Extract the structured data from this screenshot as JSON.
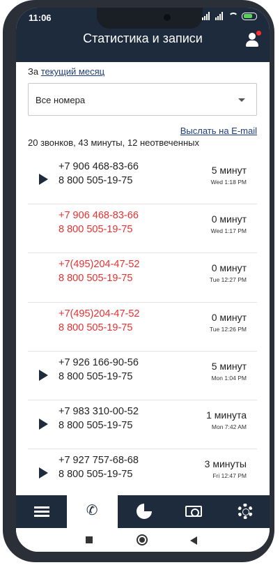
{
  "status": {
    "time": "11:06"
  },
  "header": {
    "title": "Статистика и записи",
    "profile_icon": "user-icon"
  },
  "period": {
    "prefix": "За",
    "link": "текущий месяц"
  },
  "filter": {
    "selected": "Все номера"
  },
  "email_link": "Выслать на E-mail",
  "summary": "20 звонков, 43 минуты, 12 неотвеченных",
  "colors": {
    "header_bg": "#1d2b3c",
    "missed": "#e83030",
    "link": "#1f3d7a"
  },
  "calls": [
    {
      "from": "+7 906 468-83-66",
      "to": "8 800 505-19-75",
      "duration": "5 минут",
      "time": "Wed 1:18 PM",
      "missed": false,
      "has_record": true
    },
    {
      "from": "+7 906 468-83-66",
      "to": "8 800 505-19-75",
      "duration": "0 минут",
      "time": "Wed 1:17 PM",
      "missed": true,
      "has_record": false
    },
    {
      "from": "+7(495)204-47-52",
      "to": "8 800 505-19-75",
      "duration": "0 минут",
      "time": "Tue 12:27 PM",
      "missed": true,
      "has_record": false
    },
    {
      "from": "+7(495)204-47-52",
      "to": "8 800 505-19-75",
      "duration": "0 минут",
      "time": "Tue 12:26 PM",
      "missed": true,
      "has_record": false
    },
    {
      "from": "+7 926 166-90-56",
      "to": "8 800 505-19-75",
      "duration": "5 минут",
      "time": "Mon 1:04 PM",
      "missed": false,
      "has_record": true
    },
    {
      "from": "+7 983 310-00-52",
      "to": "8 800 505-19-75",
      "duration": "1 минута",
      "time": "Mon 7:42 AM",
      "missed": false,
      "has_record": true
    },
    {
      "from": "+7 927 757-68-68",
      "to": "8 800 505-19-75",
      "duration": "3 минуты",
      "time": "Fri 12:47 PM",
      "missed": false,
      "has_record": true
    }
  ],
  "bottom_nav": [
    {
      "icon": "menu-icon",
      "active": false
    },
    {
      "icon": "phone-icon",
      "active": true
    },
    {
      "icon": "pie-chart-icon",
      "active": false
    },
    {
      "icon": "money-icon",
      "active": false
    },
    {
      "icon": "lifebuoy-icon",
      "active": false
    }
  ]
}
